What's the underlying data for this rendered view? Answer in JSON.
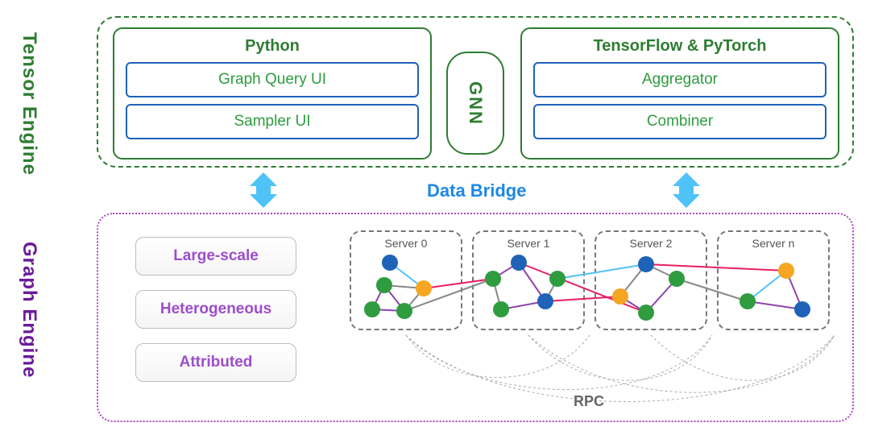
{
  "labels": {
    "tensor_engine": "Tensor Engine",
    "graph_engine": "Graph Engine",
    "data_bridge": "Data Bridge",
    "rpc": "RPC"
  },
  "top": {
    "python": {
      "title": "Python",
      "items": [
        "Graph Query UI",
        "Sampler UI"
      ]
    },
    "gnn": "GNN",
    "tf": {
      "title": "TensorFlow & PyTorch",
      "items": [
        "Aggregator",
        "Combiner"
      ]
    }
  },
  "bottom": {
    "tags": [
      "Large-scale",
      "Heterogeneous",
      "Attributed"
    ],
    "servers": [
      "Server 0",
      "Server 1",
      "Server 2",
      "Server n"
    ]
  },
  "colors": {
    "engine_green": "#2e7d32",
    "engine_purple": "#6a1b9a",
    "accent_blue": "#1e88e5",
    "node_green": "#2e9c3f",
    "node_blue": "#1e63b8",
    "node_orange": "#f5a623"
  }
}
